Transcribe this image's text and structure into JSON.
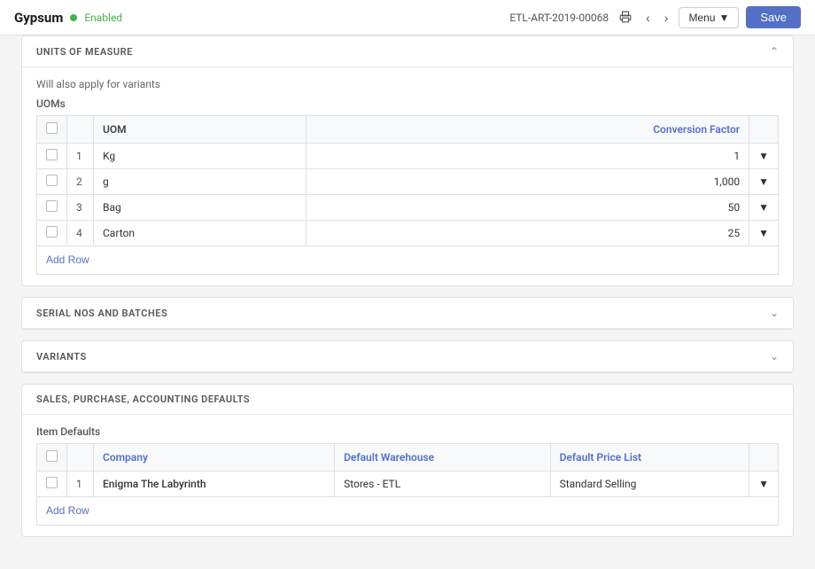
{
  "brand": {
    "name": "Gypsum",
    "status_dot_color": "#4caf50",
    "status_label": "Enabled"
  },
  "topbar": {
    "doc_id": "ETL-ART-2019-00068",
    "menu_label": "Menu",
    "save_label": "Save"
  },
  "units_of_measure": {
    "title": "UNITS OF MEASURE",
    "note": "Will also apply for variants",
    "subtitle": "UOMs",
    "columns": {
      "checkbox": "",
      "num": "",
      "uom": "UOM",
      "conversion_factor": "Conversion Factor"
    },
    "rows": [
      {
        "num": "1",
        "uom": "Kg",
        "conversion_factor": "1"
      },
      {
        "num": "2",
        "uom": "g",
        "conversion_factor": "1,000"
      },
      {
        "num": "3",
        "uom": "Bag",
        "conversion_factor": "50"
      },
      {
        "num": "4",
        "uom": "Carton",
        "conversion_factor": "25"
      }
    ],
    "add_row_label": "Add Row"
  },
  "serial_nos_batches": {
    "title": "SERIAL NOS AND BATCHES"
  },
  "variants": {
    "title": "VARIANTS"
  },
  "sales_purchase": {
    "title": "SALES, PURCHASE, ACCOUNTING DEFAULTS",
    "subtitle": "Item Defaults",
    "columns": {
      "checkbox": "",
      "num": "",
      "company": "Company",
      "default_warehouse": "Default Warehouse",
      "default_price_list": "Default Price List"
    },
    "rows": [
      {
        "num": "1",
        "company": "Enigma The Labyrinth",
        "default_warehouse": "Stores - ETL",
        "default_price_list": "Standard Selling"
      }
    ],
    "add_row_label": "Add Row"
  }
}
